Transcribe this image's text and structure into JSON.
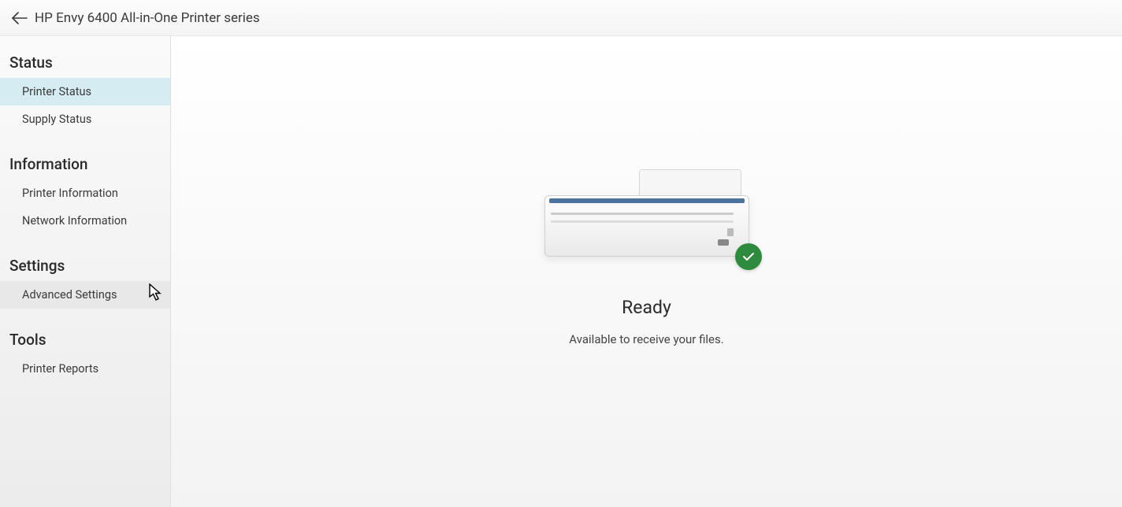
{
  "header": {
    "title": "HP Envy 6400 All-in-One Printer series"
  },
  "sidebar": {
    "sections": [
      {
        "heading": "Status",
        "items": [
          {
            "label": "Printer Status",
            "selected": true
          },
          {
            "label": "Supply Status",
            "selected": false
          }
        ]
      },
      {
        "heading": "Information",
        "items": [
          {
            "label": "Printer Information",
            "selected": false
          },
          {
            "label": "Network Information",
            "selected": false
          }
        ]
      },
      {
        "heading": "Settings",
        "items": [
          {
            "label": "Advanced Settings",
            "selected": false,
            "hovered": true
          }
        ]
      },
      {
        "heading": "Tools",
        "items": [
          {
            "label": "Printer Reports",
            "selected": false
          }
        ]
      }
    ]
  },
  "main": {
    "status_title": "Ready",
    "status_subtitle": "Available to receive your files.",
    "status_icon": "check-circle",
    "status_color": "#2e8b3d"
  }
}
